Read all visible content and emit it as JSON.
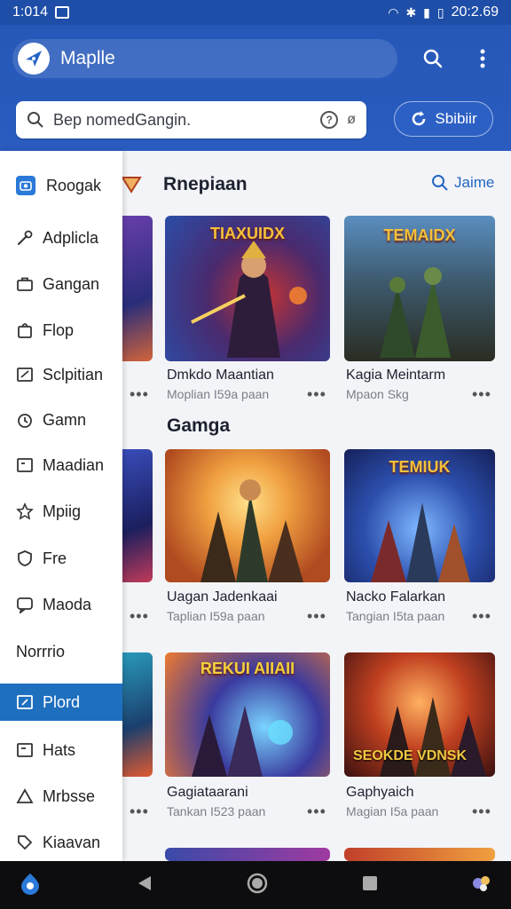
{
  "status_bar": {
    "time": "1:014",
    "right_time": "20:2.69"
  },
  "app": {
    "title": "Maplle"
  },
  "search": {
    "placeholder": "Bep nomedGangin.",
    "help_glyph": "?",
    "clear_glyph": "ø"
  },
  "submit": {
    "label": "Sbibiir"
  },
  "drawer": {
    "header": "Roogak",
    "items": [
      {
        "label": "Adplicla",
        "icon": "wrench-icon"
      },
      {
        "label": "Gangan",
        "icon": "briefcase-icon"
      },
      {
        "label": "Flop",
        "icon": "bag-icon"
      },
      {
        "label": "Sclpitian",
        "icon": "edit-box-icon"
      },
      {
        "label": "Gamn",
        "icon": "clock-icon"
      },
      {
        "label": "Maadian",
        "icon": "media-box-icon"
      },
      {
        "label": "Mpiig",
        "icon": "star-icon"
      },
      {
        "label": "Fre",
        "icon": "shield-icon"
      },
      {
        "label": "Maoda",
        "icon": "chat-icon"
      },
      {
        "label": "Norrrio",
        "icon": "none"
      },
      {
        "label": "Plord",
        "icon": "note-icon",
        "active": true
      },
      {
        "label": "Hats",
        "icon": "image-icon"
      },
      {
        "label": "Mrbsse",
        "icon": "triangle-icon"
      },
      {
        "label": "Kiaavan",
        "icon": "tag-icon"
      }
    ]
  },
  "main": {
    "section1": {
      "title": "Rnepiaan",
      "link": "Jaime"
    },
    "section2": {
      "title": "Gamga"
    },
    "cards": [
      {
        "title": "Dmkdo Maantian",
        "sub": "Moplian I59a paan",
        "art_text": "TIAXUIDX"
      },
      {
        "title": "Kagia Meintarm",
        "sub": "Mpaon Skg",
        "art_text": "TEMAIDX"
      },
      {
        "title": "Uagan Jadenkaai",
        "sub": "Taplian I59a paan",
        "art_text": ""
      },
      {
        "title": "Nacko Falarkan",
        "sub": "Tangian I5ta paan",
        "art_text": "TEMIUK"
      },
      {
        "title": "Gagiataarani",
        "sub": "Tankan I523 paan",
        "art_text": "REKUI AIIAII"
      },
      {
        "title": "Gaphyaich",
        "sub": "Magian I5a paan",
        "art_text": "SEOKDE VDNSK"
      }
    ],
    "more_glyph": "•••"
  },
  "colors": {
    "app_bar": "#2658b8",
    "accent": "#2366c4",
    "drawer_active": "#1f6fbf"
  }
}
